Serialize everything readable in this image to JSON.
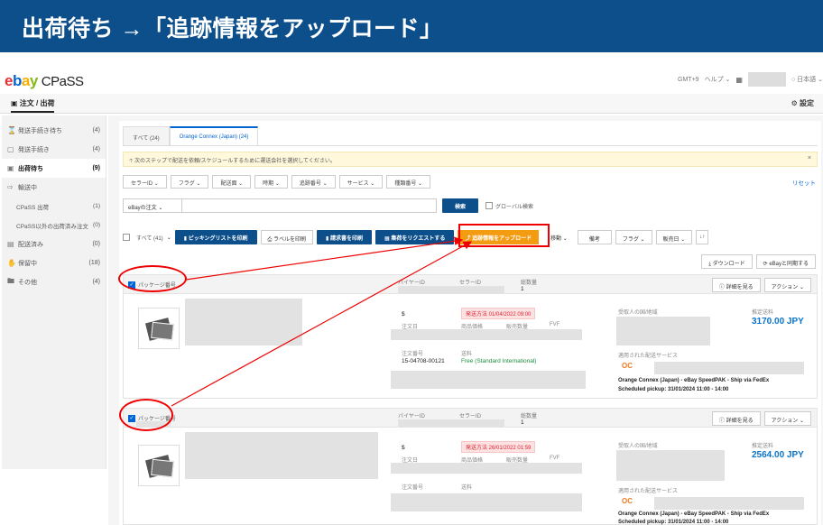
{
  "banner": {
    "title": "出荷待ち →「追跡情報をアップロード」"
  },
  "header": {
    "logo": {
      "e": "e",
      "b": "b",
      "a": "a",
      "y": "y",
      "product": "CPaSS"
    },
    "timezone": "GMT+9",
    "help": "ヘルプ",
    "language": "日本語",
    "help_chevron": "⌄",
    "lang_chevron": "⌄"
  },
  "subnav": {
    "tab": "注文 / 出荷",
    "settings": "設定"
  },
  "sidebar": {
    "items": [
      {
        "label": "発送手続き待ち",
        "count": "(4)",
        "icon": "hourglass-icon"
      },
      {
        "label": "発送手続き",
        "count": "(4)",
        "icon": "box-icon"
      },
      {
        "label": "出荷待ち",
        "count": "(9)",
        "icon": "truck-icon"
      },
      {
        "label": "輸送中",
        "count": "",
        "icon": "shipping-icon"
      },
      {
        "label": "CPaSS 出荷",
        "count": "(1)",
        "icon": ""
      },
      {
        "label": "CPaSS以外の出荷済み注文",
        "count": "(0)",
        "icon": ""
      },
      {
        "label": "配送済み",
        "count": "(0)",
        "icon": "delivered-icon"
      },
      {
        "label": "保留中",
        "count": "(18)",
        "icon": "hand-icon"
      },
      {
        "label": "その他",
        "count": "(4)",
        "icon": "folder-icon"
      }
    ]
  },
  "tabs": [
    {
      "label": "すべて (24)"
    },
    {
      "label": "Orange Connex (Japan) (24)"
    }
  ],
  "notice": {
    "text": "次のステップで配送を依頼/スケジュールするために運送会社を選択してください。",
    "close": "×"
  },
  "filters": [
    "セラーID",
    "フラグ",
    "配送面",
    "時期",
    "追跡番号",
    "サービス",
    "種類番号"
  ],
  "filter_chevron": "⌄",
  "reset": "リセット",
  "search": {
    "select": "eBayの注文",
    "button": "検索",
    "global_label": "グローバル検索"
  },
  "actions": {
    "select_all": "すべて (41)",
    "print_picking": "ピッキングリストを印刷",
    "print_label": "ラベルを印刷",
    "print_invoice": "請求書を印刷",
    "request_pickup": "集荷をリクエストする",
    "upload_tracking": "追跡情報をアップロード",
    "move": "移動",
    "memo": "備考",
    "flag": "フラグ",
    "sold_date": "販売日",
    "sort_glyph": "↓↑"
  },
  "dl": {
    "download": "ダウンロード",
    "sync": "eBayと同期する"
  },
  "package_labels": {
    "pkg_no": "パッケージ番号",
    "buyer": "バイヤーID",
    "seller": "セラーID",
    "total_qty": "総数量",
    "order_date": "注文日",
    "item_price": "商品価格",
    "sold_qty": "販売数量",
    "fvf": "FVF",
    "order_no": "注文番号",
    "postage": "送料",
    "receiver": "受取人の国/地域",
    "estimated_postage": "推定送料",
    "applied_service": "適用された配送サービス",
    "details": "詳細を見る",
    "action": "アクション",
    "ocx_logo": "OC"
  },
  "packages": [
    {
      "qty": "1",
      "currency": "$",
      "ship_tag": "発送方法 01/04/2022 09:00",
      "order_no": "15-04708-00121",
      "postage": "Free (Standard International)",
      "price": "3170.00 JPY",
      "service": "Orange Connex (Japan) - eBay SpeedPAK - Ship via FedEx",
      "pickup": "Scheduled pickup: 31/01/2024 11:00 - 14:00"
    },
    {
      "qty": "1",
      "currency": "$",
      "ship_tag": "発送方法 26/01/2022 01:59",
      "order_no": "",
      "postage": "",
      "price": "2564.00 JPY",
      "service": "Orange Connex (Japan) - eBay SpeedPAK - Ship via FedEx",
      "pickup": "Scheduled pickup: 31/01/2024 11:00 - 14:00"
    }
  ],
  "colors": {
    "banner": "#0d4f8b",
    "primary_button": "#0d4f8b",
    "upload_button": "#f39c12",
    "annotation": "#e00000",
    "price": "#0a74c9"
  }
}
